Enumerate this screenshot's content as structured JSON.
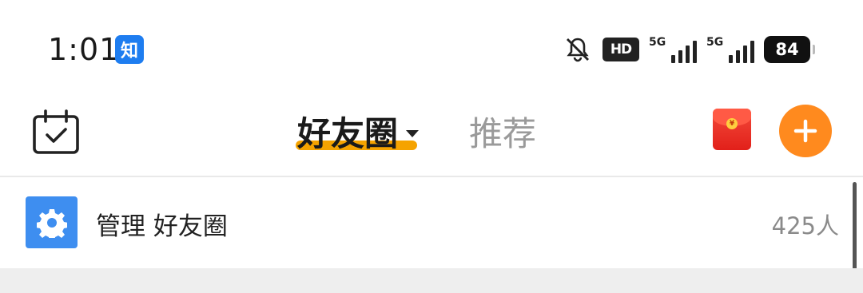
{
  "status_bar": {
    "time": "1:01",
    "app_badge": "知",
    "hd_label": "HD",
    "signal_1_label": "5G",
    "signal_2_label": "5G",
    "battery": "84"
  },
  "nav": {
    "active_tab": "好友圈",
    "inactive_tab": "推荐",
    "accent_color": "#f5a300",
    "add_button_color": "#ff8a1e"
  },
  "manage_row": {
    "label": "管理 好友圈",
    "count": "425人"
  }
}
